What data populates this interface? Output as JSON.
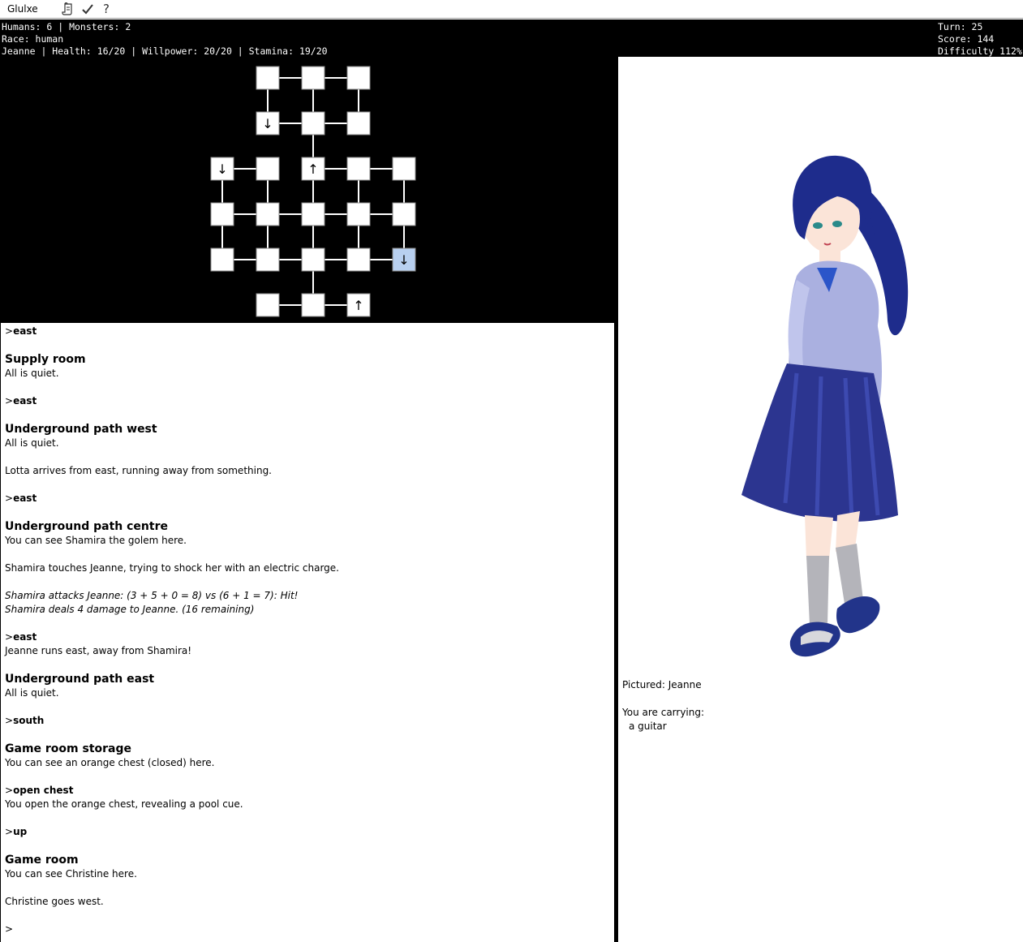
{
  "app": {
    "title": "Glulxe"
  },
  "toolbar": {
    "script_icon": "script-icon",
    "check_icon": "check-icon",
    "help_icon": "help-icon"
  },
  "status": {
    "left_line1": "Humans: 6 | Monsters: 2",
    "left_line2": "Race: human",
    "left_line3": "Jeanne | Health: 16/20 | Willpower: 20/20 | Stamina: 19/20",
    "right_line1": "Turn: 25",
    "right_line2": "Score: 144",
    "right_line3": "Difficulty 112%"
  },
  "map": {
    "colors": {
      "room": "#ffffff",
      "current": "#b8d0f0",
      "line": "#ffffff"
    },
    "arrow_down": "↓",
    "arrow_up": "↑",
    "rooms": [
      {
        "id": "r1",
        "col": 2,
        "row": 0,
        "mark": ""
      },
      {
        "id": "r2",
        "col": 3,
        "row": 0,
        "mark": ""
      },
      {
        "id": "r3",
        "col": 4,
        "row": 0,
        "mark": ""
      },
      {
        "id": "r4",
        "col": 2,
        "row": 1,
        "mark": "down"
      },
      {
        "id": "r5",
        "col": 3,
        "row": 1,
        "mark": ""
      },
      {
        "id": "r6",
        "col": 4,
        "row": 1,
        "mark": ""
      },
      {
        "id": "r7",
        "col": 1,
        "row": 2,
        "mark": "down"
      },
      {
        "id": "r8",
        "col": 2,
        "row": 2,
        "mark": ""
      },
      {
        "id": "r9",
        "col": 3,
        "row": 2,
        "mark": "up"
      },
      {
        "id": "r10",
        "col": 4,
        "row": 2,
        "mark": ""
      },
      {
        "id": "r11",
        "col": 5,
        "row": 2,
        "mark": ""
      },
      {
        "id": "r12",
        "col": 1,
        "row": 3,
        "mark": ""
      },
      {
        "id": "r13",
        "col": 2,
        "row": 3,
        "mark": ""
      },
      {
        "id": "r14",
        "col": 3,
        "row": 3,
        "mark": ""
      },
      {
        "id": "r15",
        "col": 4,
        "row": 3,
        "mark": ""
      },
      {
        "id": "r16",
        "col": 5,
        "row": 3,
        "mark": ""
      },
      {
        "id": "r17",
        "col": 1,
        "row": 4,
        "mark": ""
      },
      {
        "id": "r18",
        "col": 2,
        "row": 4,
        "mark": ""
      },
      {
        "id": "r19",
        "col": 3,
        "row": 4,
        "mark": ""
      },
      {
        "id": "r20",
        "col": 4,
        "row": 4,
        "mark": ""
      },
      {
        "id": "r21",
        "col": 5,
        "row": 4,
        "mark": "down",
        "current": true
      },
      {
        "id": "r22",
        "col": 2,
        "row": 5,
        "mark": ""
      },
      {
        "id": "r23",
        "col": 3,
        "row": 5,
        "mark": ""
      },
      {
        "id": "r24",
        "col": 4,
        "row": 5,
        "mark": "up"
      }
    ],
    "links": [
      [
        "r1",
        "r2"
      ],
      [
        "r2",
        "r3"
      ],
      [
        "r1",
        "r4"
      ],
      [
        "r2",
        "r5"
      ],
      [
        "r3",
        "r6"
      ],
      [
        "r4",
        "r5"
      ],
      [
        "r5",
        "r6"
      ],
      [
        "r5",
        "r9"
      ],
      [
        "r7",
        "r8"
      ],
      [
        "r9",
        "r10"
      ],
      [
        "r10",
        "r11"
      ],
      [
        "r7",
        "r12"
      ],
      [
        "r8",
        "r13"
      ],
      [
        "r9",
        "r14"
      ],
      [
        "r10",
        "r15"
      ],
      [
        "r11",
        "r16"
      ],
      [
        "r12",
        "r13"
      ],
      [
        "r13",
        "r14"
      ],
      [
        "r14",
        "r15"
      ],
      [
        "r15",
        "r16"
      ],
      [
        "r12",
        "r17"
      ],
      [
        "r13",
        "r18"
      ],
      [
        "r14",
        "r19"
      ],
      [
        "r15",
        "r20"
      ],
      [
        "r16",
        "r21"
      ],
      [
        "r17",
        "r18"
      ],
      [
        "r18",
        "r19"
      ],
      [
        "r19",
        "r20"
      ],
      [
        "r20",
        "r21"
      ],
      [
        "r19",
        "r23"
      ],
      [
        "r22",
        "r23"
      ],
      [
        "r23",
        "r24"
      ]
    ]
  },
  "story": {
    "prompt": ">",
    "c1": "east",
    "room1": "Supply room",
    "t1": "All is quiet.",
    "c2": "east",
    "room2": "Underground path west",
    "t2": "All is quiet.",
    "t3": "Lotta arrives from east, running away from something.",
    "c3": "east",
    "room3": "Underground path centre",
    "t4": "You can see Shamira the golem here.",
    "t5": "Shamira touches Jeanne, trying to shock her with an electric charge.",
    "t6": "Shamira attacks Jeanne: (3 + 5 + 0 = 8) vs (6 + 1 = 7): Hit!",
    "t7": "Shamira deals 4 damage to Jeanne. (16 remaining)",
    "c4": "east",
    "t8": "Jeanne runs east, away from Shamira!",
    "room4": "Underground path east",
    "t9": "All is quiet.",
    "c5": "south",
    "room5": "Game room storage",
    "t10": "You can see an orange chest (closed) here.",
    "c6": "open chest",
    "t11": "You open the orange chest, revealing a pool cue.",
    "c7": "up",
    "room6": "Game room",
    "t12": "You can see Christine here.",
    "t13": "Christine goes west."
  },
  "picture": {
    "pictured": "Pictured: Jeanne",
    "carrying": "You are carrying:",
    "item1": "a guitar",
    "colors": {
      "hair": "#1e2c8c",
      "sweater": "#aab0e0",
      "skirt": "#2c3590",
      "skin": "#fbe4d8",
      "socks": "#b4b4ba",
      "shoes": "#22348a"
    }
  }
}
